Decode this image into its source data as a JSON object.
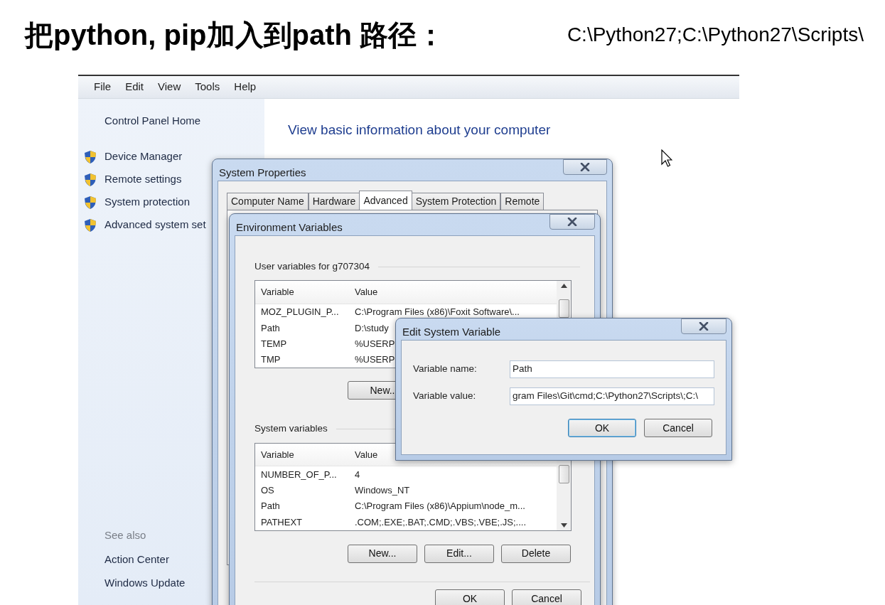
{
  "slide": {
    "title": "把python, pip加入到path 路径：",
    "path_text": "C:\\Python27;C:\\Python27\\Scripts\\"
  },
  "menu": [
    "File",
    "Edit",
    "View",
    "Tools",
    "Help"
  ],
  "sidebar": {
    "home": "Control Panel Home",
    "items": [
      "Device Manager",
      "Remote settings",
      "System protection",
      "Advanced system set"
    ],
    "see_also": "See also",
    "links": [
      "Action Center",
      "Windows Update"
    ]
  },
  "content": {
    "heading": "View basic information about your computer"
  },
  "system_properties": {
    "title": "System Properties",
    "tabs": [
      {
        "label": "Computer Name",
        "selected": false
      },
      {
        "label": "Hardware",
        "selected": false
      },
      {
        "label": "Advanced",
        "selected": true
      },
      {
        "label": "System Protection",
        "selected": false
      },
      {
        "label": "Remote",
        "selected": false
      }
    ]
  },
  "environment_variables": {
    "title": "Environment Variables",
    "user_group": "User variables for g707304",
    "user_columns": [
      "Variable",
      "Value"
    ],
    "user_rows": [
      {
        "variable": "MOZ_PLUGIN_P...",
        "value": "C:\\Program Files (x86)\\Foxit Software\\..."
      },
      {
        "variable": "Path",
        "value": "D:\\study"
      },
      {
        "variable": "TEMP",
        "value": "%USERP"
      },
      {
        "variable": "TMP",
        "value": "%USERP"
      }
    ],
    "user_buttons": [
      "New.."
    ],
    "system_group": "System variables",
    "system_columns": [
      "Variable",
      "Value"
    ],
    "system_rows": [
      {
        "variable": "NUMBER_OF_P...",
        "value": "4"
      },
      {
        "variable": "OS",
        "value": "Windows_NT"
      },
      {
        "variable": "Path",
        "value": "C:\\Program Files (x86)\\Appium\\node_m..."
      },
      {
        "variable": "PATHEXT",
        "value": ".COM;.EXE;.BAT;.CMD;.VBS;.VBE;.JS;...."
      }
    ],
    "system_buttons": [
      "New...",
      "Edit...",
      "Delete"
    ],
    "buttons": [
      "OK",
      "Cancel"
    ]
  },
  "edit_system_variable": {
    "title": "Edit System Variable",
    "fields": [
      {
        "label": "Variable name:",
        "value": "Path"
      },
      {
        "label": "Variable value:",
        "value": "gram Files\\Git\\cmd;C:\\Python27\\Scripts\\;C:\\"
      }
    ],
    "buttons": [
      {
        "label": "OK",
        "default": true
      },
      {
        "label": "Cancel",
        "default": false
      }
    ]
  }
}
